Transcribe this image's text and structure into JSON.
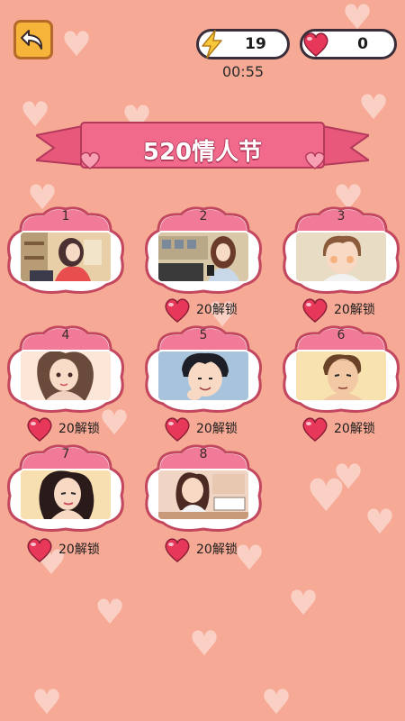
{
  "topbar": {
    "energy": "19",
    "hearts": "0",
    "timer": "00:55"
  },
  "banner": {
    "title": "520情人节"
  },
  "levels": [
    {
      "number": "1",
      "locked": false,
      "scene": "girl-laptop-icon"
    },
    {
      "number": "2",
      "locked": true,
      "scene": "girl-phone-icon",
      "cost": "20解锁"
    },
    {
      "number": "3",
      "locked": true,
      "scene": "boy-blush-icon",
      "cost": "20解锁"
    },
    {
      "number": "4",
      "locked": true,
      "scene": "girl-portrait-icon",
      "cost": "20解锁"
    },
    {
      "number": "5",
      "locked": true,
      "scene": "boy-smile-icon",
      "cost": "20解锁"
    },
    {
      "number": "6",
      "locked": true,
      "scene": "man-portrait-icon",
      "cost": "20解锁"
    },
    {
      "number": "7",
      "locked": true,
      "scene": "woman-portrait-icon",
      "cost": "20解锁"
    },
    {
      "number": "8",
      "locked": true,
      "scene": "girl-desk-icon",
      "cost": "20解锁"
    }
  ],
  "colors": {
    "background": "#f6a995",
    "cloud_border": "#c2475f",
    "cloud_top": "#f17a98",
    "heart": "#e8385a",
    "back_button": "#f7b43a"
  }
}
